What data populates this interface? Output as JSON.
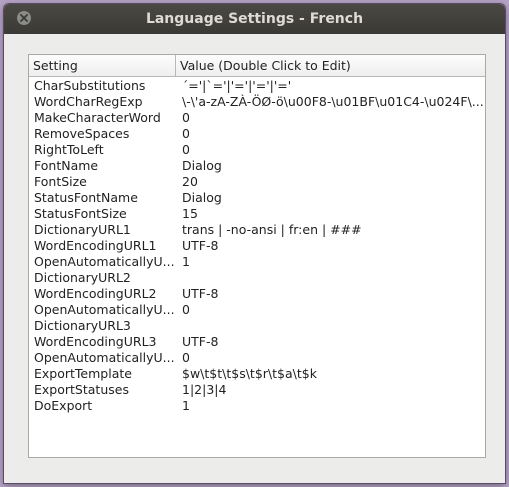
{
  "window": {
    "title": "Language Settings - French",
    "close_icon": "close-icon"
  },
  "table": {
    "columns": [
      "Setting",
      "Value (Double Click to Edit)"
    ],
    "rows": [
      {
        "setting": "CharSubstitutions",
        "value": "´='|`='|'='|'='|'='"
      },
      {
        "setting": "WordCharRegExp",
        "value": "\\-\\'a-zA-ZÀ-ÖØ-ö\\u00F8-\\u01BF\\u01C4-\\u024F\\..."
      },
      {
        "setting": "MakeCharacterWord",
        "value": "0"
      },
      {
        "setting": "RemoveSpaces",
        "value": "0"
      },
      {
        "setting": "RightToLeft",
        "value": "0"
      },
      {
        "setting": "FontName",
        "value": "Dialog"
      },
      {
        "setting": "FontSize",
        "value": "20"
      },
      {
        "setting": "StatusFontName",
        "value": "Dialog"
      },
      {
        "setting": "StatusFontSize",
        "value": "15"
      },
      {
        "setting": "DictionaryURL1",
        "value": "trans | -no-ansi | fr:en | ###"
      },
      {
        "setting": "WordEncodingURL1",
        "value": "UTF-8"
      },
      {
        "setting": "OpenAutomaticallyU...",
        "value": "1"
      },
      {
        "setting": "DictionaryURL2",
        "value": ""
      },
      {
        "setting": "WordEncodingURL2",
        "value": "UTF-8"
      },
      {
        "setting": "OpenAutomaticallyU...",
        "value": "0"
      },
      {
        "setting": "DictionaryURL3",
        "value": ""
      },
      {
        "setting": "WordEncodingURL3",
        "value": "UTF-8"
      },
      {
        "setting": "OpenAutomaticallyU...",
        "value": "0"
      },
      {
        "setting": "ExportTemplate",
        "value": "$w\\t$t\\t$s\\t$r\\t$a\\t$k"
      },
      {
        "setting": "ExportStatuses",
        "value": "1|2|3|4"
      },
      {
        "setting": "DoExport",
        "value": "1"
      }
    ]
  }
}
